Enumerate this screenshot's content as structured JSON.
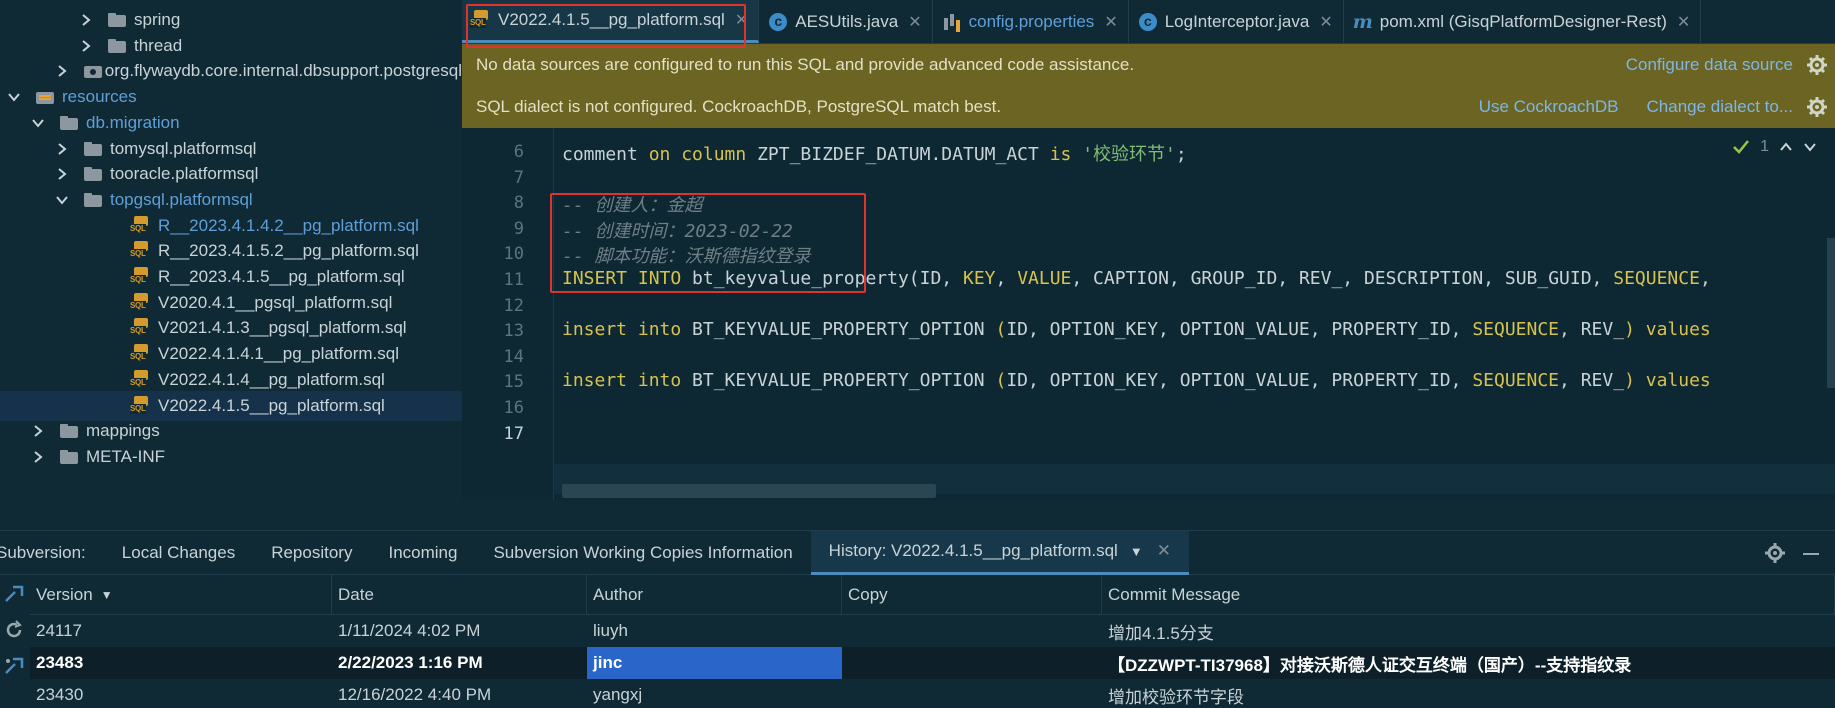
{
  "tree": {
    "items": [
      {
        "label": "spring",
        "indent": 3,
        "arrow": "right",
        "icon": "folder",
        "color": "normal"
      },
      {
        "label": "thread",
        "indent": 3,
        "arrow": "right",
        "icon": "folder",
        "color": "normal"
      },
      {
        "label": "org.flywaydb.core.internal.dbsupport.postgresql",
        "indent": 2,
        "arrow": "right",
        "icon": "pkg",
        "color": "normal"
      },
      {
        "label": "resources",
        "indent": 0,
        "arrow": "down",
        "icon": "res",
        "color": "blue"
      },
      {
        "label": "db.migration",
        "indent": 1,
        "arrow": "down",
        "icon": "folder",
        "color": "blue"
      },
      {
        "label": "tomysql.platformsql",
        "indent": 2,
        "arrow": "right",
        "icon": "folder",
        "color": "normal"
      },
      {
        "label": "tooracle.platformsql",
        "indent": 2,
        "arrow": "right",
        "icon": "folder",
        "color": "normal"
      },
      {
        "label": "topgsql.platformsql",
        "indent": 2,
        "arrow": "down",
        "icon": "folder",
        "color": "blue"
      },
      {
        "label": "R__2023.4.1.4.2__pg_platform.sql",
        "indent": 4,
        "arrow": "none",
        "icon": "sql",
        "color": "blue"
      },
      {
        "label": "R__2023.4.1.5.2__pg_platform.sql",
        "indent": 4,
        "arrow": "none",
        "icon": "sql",
        "color": "normal"
      },
      {
        "label": "R__2023.4.1.5__pg_platform.sql",
        "indent": 4,
        "arrow": "none",
        "icon": "sql",
        "color": "normal"
      },
      {
        "label": "V2020.4.1__pgsql_platform.sql",
        "indent": 4,
        "arrow": "none",
        "icon": "sql",
        "color": "normal"
      },
      {
        "label": "V2021.4.1.3__pgsql_platform.sql",
        "indent": 4,
        "arrow": "none",
        "icon": "sql",
        "color": "normal"
      },
      {
        "label": "V2022.4.1.4.1__pg_platform.sql",
        "indent": 4,
        "arrow": "none",
        "icon": "sql",
        "color": "normal"
      },
      {
        "label": "V2022.4.1.4__pg_platform.sql",
        "indent": 4,
        "arrow": "none",
        "icon": "sql",
        "color": "normal"
      },
      {
        "label": "V2022.4.1.5__pg_platform.sql",
        "indent": 4,
        "arrow": "none",
        "icon": "sql",
        "color": "normal",
        "selected": true
      },
      {
        "label": "mappings",
        "indent": 1,
        "arrow": "right",
        "icon": "folder",
        "color": "normal"
      },
      {
        "label": "META-INF",
        "indent": 1,
        "arrow": "right",
        "icon": "folder",
        "color": "normal"
      }
    ]
  },
  "tabs": [
    {
      "label": "V2022.4.1.5__pg_platform.sql",
      "icon": "sql",
      "active": true,
      "color": "normal"
    },
    {
      "label": "AESUtils.java",
      "icon": "c",
      "color": "normal"
    },
    {
      "label": "config.properties",
      "icon": "props",
      "color": "blue"
    },
    {
      "label": "LogInterceptor.java",
      "icon": "c",
      "color": "normal"
    },
    {
      "label": "pom.xml (GisqPlatformDesigner-Rest)",
      "icon": "m",
      "color": "normal"
    }
  ],
  "banner1": {
    "text": "No data sources are configured to run this SQL and provide advanced code assistance.",
    "link": "Configure data source"
  },
  "banner2": {
    "text": "SQL dialect is not configured. CockroachDB, PostgreSQL match best.",
    "link1": "Use CockroachDB",
    "link2": "Change dialect to..."
  },
  "editor": {
    "inspection_count": "1",
    "lines": [
      {
        "num": "6"
      },
      {
        "num": "7"
      },
      {
        "num": "8"
      },
      {
        "num": "9"
      },
      {
        "num": "10"
      },
      {
        "num": "11"
      },
      {
        "num": "12"
      },
      {
        "num": "13"
      },
      {
        "num": "14"
      },
      {
        "num": "15"
      },
      {
        "num": "16"
      },
      {
        "num": "17"
      }
    ],
    "line6": {
      "a": "comment ",
      "b": "on column ",
      "c": "ZPT_BIZDEF_DATUM.DATUM_ACT ",
      "d": "is ",
      "e": "'校验环节'",
      "f": ";"
    },
    "line8": "-- 创建人：金超",
    "line9": "-- 创建时间：2023-02-22",
    "line10": "-- 脚本功能：沃斯德指纹登录",
    "line11": {
      "a": "INSERT INTO ",
      "b": "bt_keyvalue_property(ID, ",
      "c": "KEY",
      "d": ", ",
      "e": "VALUE",
      "f": ", CAPTION, GROUP_ID, REV_, DESCRIPTION, SUB_GUID, ",
      "g": "SEQUENCE",
      "h": ","
    },
    "line13": {
      "a": "insert into ",
      "b": "BT_KEYVALUE_PROPERTY_OPTION ",
      "c": "(",
      "d": "ID, OPTION_KEY, OPTION_VALUE, PROPERTY_ID, ",
      "e": "SEQUENCE",
      "f": ", REV_",
      "g": ") ",
      "h": "values"
    },
    "line15": {
      "a": "insert into ",
      "b": "BT_KEYVALUE_PROPERTY_OPTION ",
      "c": "(",
      "d": "ID, OPTION_KEY, OPTION_VALUE, PROPERTY_ID, ",
      "e": "SEQUENCE",
      "f": ", REV_",
      "g": ") ",
      "h": "values"
    }
  },
  "svn": {
    "tabs": [
      "Subversion:",
      "Local Changes",
      "Repository",
      "Incoming",
      "Subversion Working Copies Information",
      "History: V2022.4.1.5__pg_platform.sql"
    ],
    "columns": [
      "Version",
      "Date",
      "Author",
      "Copy",
      "Commit Message"
    ],
    "rows": [
      {
        "version": "24117",
        "date": "1/11/2024 4:02 PM",
        "author": "liuyh",
        "copy": "",
        "message": "增加4.1.5分支"
      },
      {
        "version": "23483",
        "date": "2/22/2023 1:16 PM",
        "author": "jinc",
        "copy": "",
        "message": "【DZZWPT-TI37968】对接沃斯德人证交互终端（国产）--支持指纹录",
        "selected": true
      },
      {
        "version": "23430",
        "date": "12/16/2022 4:40 PM",
        "author": "yangxj",
        "copy": "",
        "message": "增加校验环节字段"
      }
    ]
  },
  "colors": {
    "accent": "#4b8bbe",
    "highlight_box": "#e0332e",
    "banner_bg": "#6b6422",
    "selection": "#2a66c9"
  }
}
